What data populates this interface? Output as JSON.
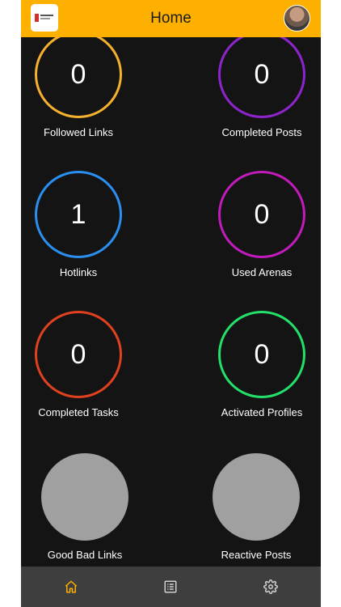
{
  "header": {
    "title": "Home"
  },
  "colors": {
    "header_bg": "#fdb000",
    "nav_active": "#fdb000",
    "nav_inactive": "#d0d0d0",
    "rings": {
      "followed_links": "#f5b12e",
      "completed_posts": "#8e24cc",
      "hotlinks": "#2b8ff0",
      "used_arenas": "#c11cbb",
      "completed_tasks": "#e0411f",
      "activated_profiles": "#22e06a"
    }
  },
  "stats": {
    "followed_links": {
      "value": "0",
      "label": "Followed Links"
    },
    "completed_posts": {
      "value": "0",
      "label": "Completed Posts"
    },
    "hotlinks": {
      "value": "1",
      "label": "Hotlinks"
    },
    "used_arenas": {
      "value": "0",
      "label": "Used Arenas"
    },
    "completed_tasks": {
      "value": "0",
      "label": "Completed Tasks"
    },
    "activated_profiles": {
      "value": "0",
      "label": "Activated Profiles"
    },
    "good_bad_links": {
      "label": "Good Bad Links"
    },
    "reactive_posts": {
      "label": "Reactive Posts"
    }
  },
  "nav": [
    {
      "icon": "home-icon",
      "active": true
    },
    {
      "icon": "list-icon",
      "active": false
    },
    {
      "icon": "gear-icon",
      "active": false
    }
  ]
}
